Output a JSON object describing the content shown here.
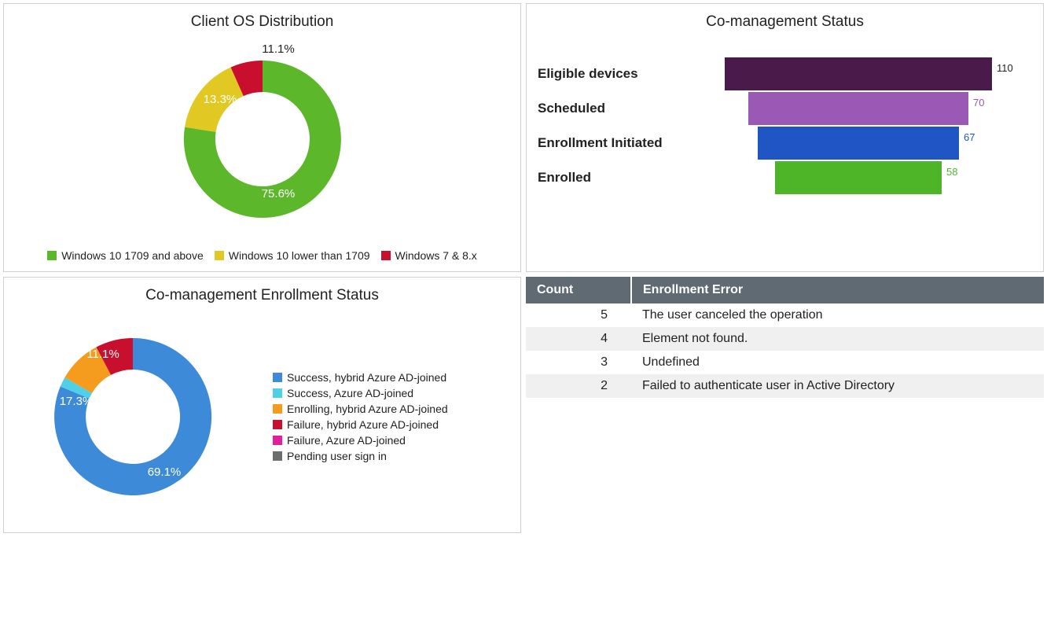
{
  "panels": {
    "os_dist": {
      "title": "Client OS Distribution",
      "legend": [
        {
          "label": "Windows 10 1709 and above",
          "color": "#5cb82a"
        },
        {
          "label": "Windows 10 lower than 1709",
          "color": "#e2c822"
        },
        {
          "label": "Windows 7 & 8.x",
          "color": "#c8102e"
        }
      ],
      "slice_labels": {
        "a": "75.6%",
        "b": "11.1%",
        "c": "13.3%"
      }
    },
    "comgmt_status": {
      "title": "Co-management Status",
      "rows": [
        {
          "label": "Eligible devices",
          "value": "110",
          "color": "#4a1a4a",
          "vcolor": "#222222"
        },
        {
          "label": "Scheduled",
          "value": "70",
          "color": "#9b59b6",
          "vcolor": "#9b59b6"
        },
        {
          "label": "Enrollment Initiated",
          "value": "67",
          "color": "#1f56c4",
          "vcolor": "#1f56c4"
        },
        {
          "label": "Enrolled",
          "value": "58",
          "color": "#4fb528",
          "vcolor": "#4fb528"
        }
      ]
    },
    "enroll_status": {
      "title": "Co-management Enrollment Status",
      "legend": [
        {
          "label": "Success, hybrid Azure AD-joined",
          "color": "#3c8ad8"
        },
        {
          "label": "Success, Azure AD-joined",
          "color": "#4fd0e6"
        },
        {
          "label": "Enrolling, hybrid Azure AD-joined",
          "color": "#f59c1e"
        },
        {
          "label": "Failure, hybrid Azure AD-joined",
          "color": "#c8102e"
        },
        {
          "label": "Failure, Azure AD-joined",
          "color": "#e21e9d"
        },
        {
          "label": "Pending user sign in",
          "color": "#6d6d6d"
        }
      ],
      "slice_labels": {
        "a": "69.1%",
        "b": "11.1%",
        "c": "17.3%"
      }
    },
    "errors": {
      "headers": {
        "count": "Count",
        "error": "Enrollment Error"
      },
      "rows": [
        {
          "count": "5",
          "error": "The user canceled the operation"
        },
        {
          "count": "4",
          "error": "Element not found."
        },
        {
          "count": "3",
          "error": "Undefined"
        },
        {
          "count": "2",
          "error": "Failed to authenticate user in Active Directory"
        }
      ]
    }
  },
  "chart_data": [
    {
      "type": "pie",
      "title": "Client OS Distribution",
      "series": [
        {
          "name": "Windows 10 1709 and above",
          "value": 75.6
        },
        {
          "name": "Windows 10 lower than 1709",
          "value": 11.1
        },
        {
          "name": "Windows 7 & 8.x",
          "value": 13.3
        }
      ]
    },
    {
      "type": "bar",
      "title": "Co-management Status",
      "categories": [
        "Eligible devices",
        "Scheduled",
        "Enrollment Initiated",
        "Enrolled"
      ],
      "values": [
        110,
        70,
        67,
        58
      ],
      "xlabel": "",
      "ylabel": "",
      "ylim": [
        0,
        110
      ]
    },
    {
      "type": "pie",
      "title": "Co-management Enrollment Status",
      "series": [
        {
          "name": "Success, hybrid Azure AD-joined",
          "value": 69.1
        },
        {
          "name": "Success, Azure AD-joined",
          "value": 2.5
        },
        {
          "name": "Enrolling, hybrid Azure AD-joined",
          "value": 11.1
        },
        {
          "name": "Failure, hybrid Azure AD-joined",
          "value": 17.3
        },
        {
          "name": "Failure, Azure AD-joined",
          "value": 0.0
        },
        {
          "name": "Pending user sign in",
          "value": 0.0
        }
      ]
    },
    {
      "type": "table",
      "title": "Enrollment Error",
      "columns": [
        "Count",
        "Enrollment Error"
      ],
      "rows": [
        [
          5,
          "The user canceled the operation"
        ],
        [
          4,
          "Element not found."
        ],
        [
          3,
          "Undefined"
        ],
        [
          2,
          "Failed to authenticate user in Active Directory"
        ]
      ]
    }
  ]
}
